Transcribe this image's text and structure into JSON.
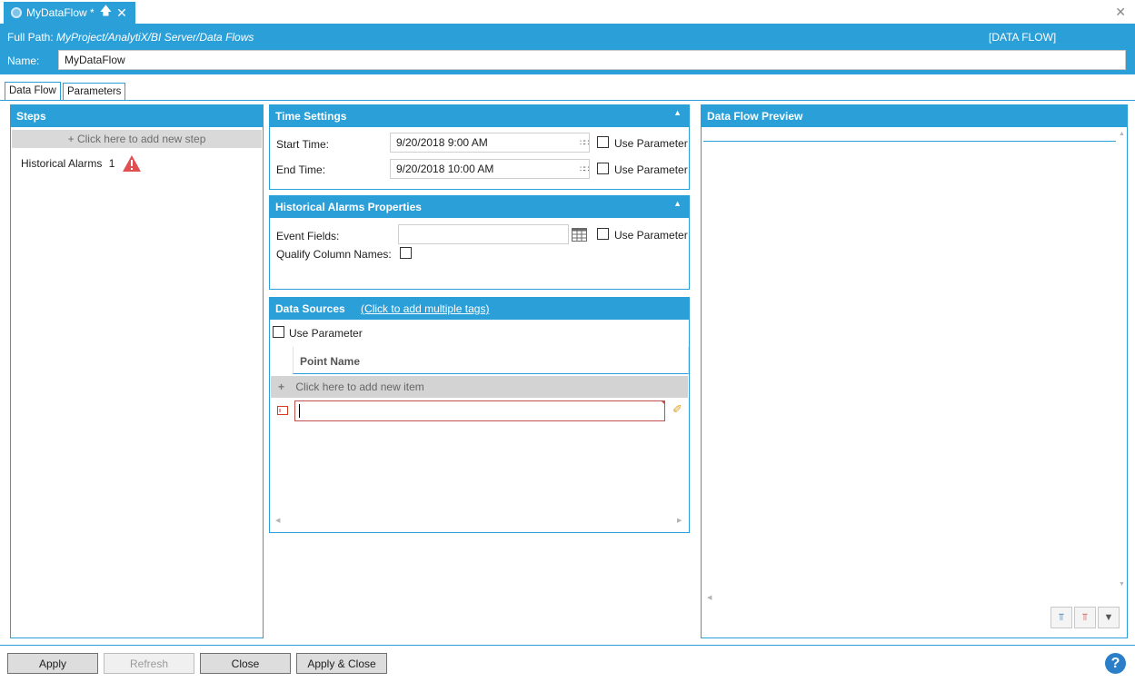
{
  "tab": {
    "title": "MyDataFlow *"
  },
  "header": {
    "full_path_label": "Full Path:",
    "full_path_value": "MyProject/AnalytiX/BI Server/Data Flows",
    "type_label": "[DATA FLOW]",
    "name_label": "Name:",
    "name_value": "MyDataFlow"
  },
  "subtabs": [
    "Data Flow",
    "Parameters"
  ],
  "steps": {
    "title": "Steps",
    "add_label": "+ Click here to add new step",
    "items": [
      {
        "label": "Historical Alarms",
        "count": "1"
      }
    ]
  },
  "time_settings": {
    "title": "Time Settings",
    "start_label": "Start Time:",
    "start_value": "9/20/2018 9:00 AM",
    "end_label": "End Time:",
    "end_value": "9/20/2018 10:00 AM",
    "use_param_label": "Use Parameter"
  },
  "historical_props": {
    "title": "Historical Alarms Properties",
    "event_fields_label": "Event Fields:",
    "event_fields_value": "",
    "qualify_label": "Qualify Column Names:",
    "use_param_label": "Use Parameter"
  },
  "data_sources": {
    "title": "Data Sources",
    "link": "(Click to add multiple tags)",
    "use_param_label": "Use Parameter",
    "column_header": "Point Name",
    "add_item_label": "Click here to add new item",
    "row_value": ""
  },
  "preview": {
    "title": "Data Flow Preview"
  },
  "buttons": {
    "apply": "Apply",
    "refresh": "Refresh",
    "close": "Close",
    "apply_close": "Apply & Close"
  },
  "colors": {
    "accent": "#2a9fd8",
    "warning": "#e05050"
  }
}
